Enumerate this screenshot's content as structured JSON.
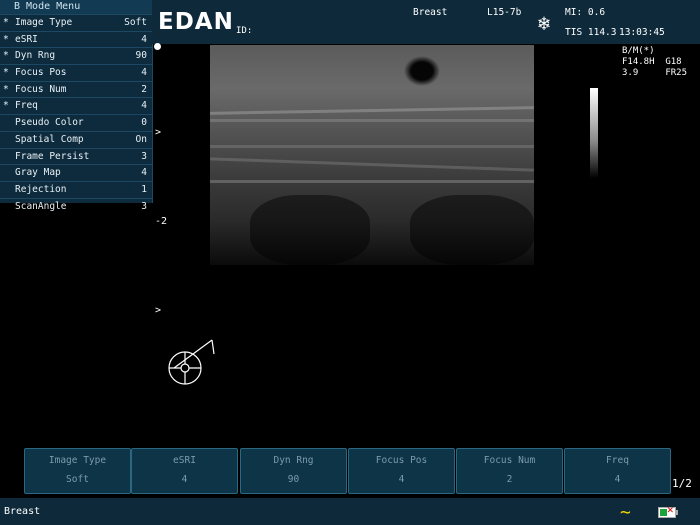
{
  "menu": {
    "title": "B Mode Menu",
    "items": [
      {
        "star": "*",
        "label": "Image Type",
        "value": "Soft"
      },
      {
        "star": "*",
        "label": "eSRI",
        "value": "4"
      },
      {
        "star": "*",
        "label": "Dyn Rng",
        "value": "90"
      },
      {
        "star": "*",
        "label": "Focus Pos",
        "value": "4"
      },
      {
        "star": "*",
        "label": "Focus Num",
        "value": "2"
      },
      {
        "star": "*",
        "label": "Freq",
        "value": "4"
      },
      {
        "star": "",
        "label": "Pseudo Color",
        "value": "0"
      },
      {
        "star": "",
        "label": "Spatial Comp",
        "value": "On"
      },
      {
        "star": "",
        "label": "Frame Persist",
        "value": "3"
      },
      {
        "star": "",
        "label": "Gray Map",
        "value": "4"
      },
      {
        "star": "",
        "label": "Rejection",
        "value": "1"
      },
      {
        "star": "",
        "label": "ScanAngle",
        "value": "3"
      }
    ]
  },
  "header": {
    "logo": "EDAN",
    "id_label": "ID:",
    "exam": "Breast",
    "probe": "L15-7b",
    "mi": "MI: 0.6",
    "tis": "TIS 114.3",
    "time": "13:03:45",
    "freeze_icon": "snowflake-icon"
  },
  "status": {
    "line1": "B/M(*)",
    "line2": "F14.8H  G18",
    "line3": "3.9     FR25"
  },
  "depth": {
    "marker_top": ">",
    "marker_mid": "2",
    "marker_bottom": ">"
  },
  "softkeys": [
    {
      "label": "Image Type",
      "value": "Soft"
    },
    {
      "label": "eSRI",
      "value": "4"
    },
    {
      "label": "Dyn Rng",
      "value": "90"
    },
    {
      "label": "Focus Pos",
      "value": "4"
    },
    {
      "label": "Focus Num",
      "value": "2"
    },
    {
      "label": "Freq",
      "value": "4"
    }
  ],
  "page_indicator": "1/2",
  "footer": {
    "exam": "Breast"
  },
  "colors": {
    "panel": "#0e2a3a",
    "softkey": "#0d3447",
    "wave": "#f2d300"
  }
}
